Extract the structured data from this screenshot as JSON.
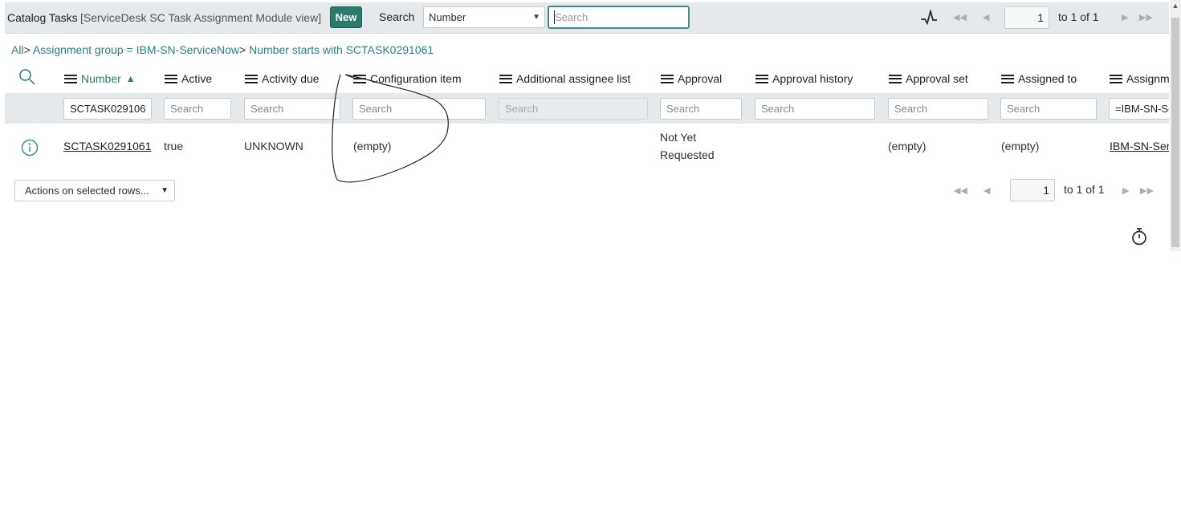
{
  "header": {
    "title": "Catalog Tasks",
    "view": "[ServiceDesk SC Task Assignment Module view]",
    "new_label": "New",
    "search_label": "Search",
    "search_field": "Number",
    "search_placeholder": "Search"
  },
  "pagination": {
    "page": "1",
    "total": "to 1 of 1"
  },
  "breadcrumb": {
    "all": "All",
    "sep": ">",
    "crumb1": "Assignment group = IBM-SN-ServiceNow",
    "crumb2": "Number starts with SCTASK0291061"
  },
  "table": {
    "columns": {
      "number": "Number",
      "number_sort": "▲",
      "active": "Active",
      "activity_due": "Activity due",
      "configuration_item": "Configuration item",
      "additional_assignee_list": "Additional assignee list",
      "approval": "Approval",
      "approval_history": "Approval history",
      "approval_set": "Approval set",
      "assigned_to": "Assigned to",
      "assignment_group": "Assignm"
    },
    "filters": {
      "placeholder": "Search",
      "number": "SCTASK029106",
      "assignment_group": "=IBM-SN-Se"
    },
    "row": {
      "number": "SCTASK0291061",
      "active": "true",
      "activity_due": "UNKNOWN",
      "configuration_item": "(empty)",
      "approval_line1": "Not Yet",
      "approval_line2": "Requested",
      "approval_set": "(empty)",
      "assigned_to": "(empty)",
      "assignment_group": "IBM-SN-Ser"
    }
  },
  "footer": {
    "actions_label": "Actions on selected rows..."
  },
  "icons": {
    "activity": "activity-stream-icon",
    "search": "search-icon",
    "info": "info-icon",
    "timer": "response-time-icon"
  },
  "colors": {
    "accent": "#2b7a6c",
    "link": "#2e8076",
    "header_bg": "#e6e9eb"
  }
}
